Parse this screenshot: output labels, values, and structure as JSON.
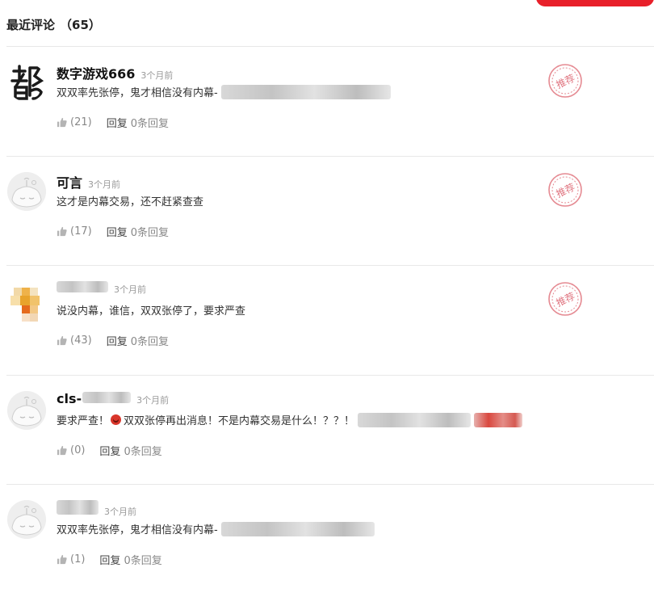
{
  "header": {
    "title": "最近评论",
    "count": "（65）"
  },
  "actions_common": {
    "reply_label": "回复"
  },
  "stamp_text": "推荐",
  "comments": [
    {
      "username": "数字游戏666",
      "time": "3个月前",
      "text": "双双率先张停，鬼才相信没有内幕-",
      "likes": "(21)",
      "reply_count": "0条回复",
      "recommended": true,
      "avatar": "calligraphy-avatar"
    },
    {
      "username": "可言",
      "time": "3个月前",
      "text": "这才是内幕交易，还不赶紧查查",
      "likes": "(17)",
      "reply_count": "0条回复",
      "recommended": true,
      "avatar": "default-avatar"
    },
    {
      "username": "",
      "time": "3个月前",
      "text": "说没内幕，谁信，双双张停了，要求严查",
      "likes": "(43)",
      "reply_count": "0条回复",
      "recommended": true,
      "avatar": "mosaic-avatar"
    },
    {
      "username": "cls-",
      "time": "3个月前",
      "text_before": "要求严查！",
      "text": "双双张停再出消息！不是内幕交易是什么！？？！",
      "likes": "(0)",
      "reply_count": "0条回复",
      "recommended": false,
      "avatar": "default-avatar"
    },
    {
      "username": "",
      "time": "3个月前",
      "text": "双双率先张停，鬼才相信没有内幕-",
      "likes": "(1)",
      "reply_count": "0条回复",
      "recommended": false,
      "avatar": "default-avatar"
    }
  ]
}
